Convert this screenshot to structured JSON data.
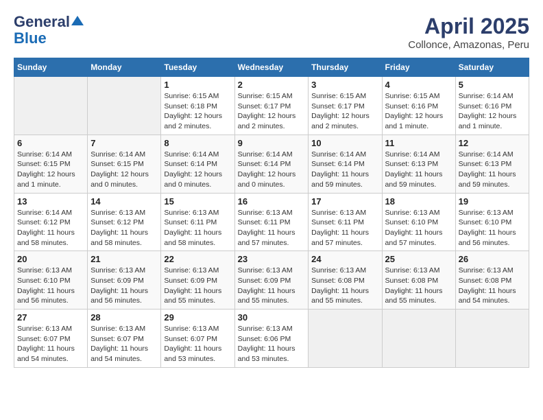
{
  "header": {
    "logo_line1": "General",
    "logo_line2": "Blue",
    "title": "April 2025",
    "subtitle": "Collonce, Amazonas, Peru"
  },
  "weekdays": [
    "Sunday",
    "Monday",
    "Tuesday",
    "Wednesday",
    "Thursday",
    "Friday",
    "Saturday"
  ],
  "weeks": [
    [
      {
        "day": "",
        "detail": ""
      },
      {
        "day": "",
        "detail": ""
      },
      {
        "day": "1",
        "detail": "Sunrise: 6:15 AM\nSunset: 6:18 PM\nDaylight: 12 hours and 2 minutes."
      },
      {
        "day": "2",
        "detail": "Sunrise: 6:15 AM\nSunset: 6:17 PM\nDaylight: 12 hours and 2 minutes."
      },
      {
        "day": "3",
        "detail": "Sunrise: 6:15 AM\nSunset: 6:17 PM\nDaylight: 12 hours and 2 minutes."
      },
      {
        "day": "4",
        "detail": "Sunrise: 6:15 AM\nSunset: 6:16 PM\nDaylight: 12 hours and 1 minute."
      },
      {
        "day": "5",
        "detail": "Sunrise: 6:14 AM\nSunset: 6:16 PM\nDaylight: 12 hours and 1 minute."
      }
    ],
    [
      {
        "day": "6",
        "detail": "Sunrise: 6:14 AM\nSunset: 6:15 PM\nDaylight: 12 hours and 1 minute."
      },
      {
        "day": "7",
        "detail": "Sunrise: 6:14 AM\nSunset: 6:15 PM\nDaylight: 12 hours and 0 minutes."
      },
      {
        "day": "8",
        "detail": "Sunrise: 6:14 AM\nSunset: 6:14 PM\nDaylight: 12 hours and 0 minutes."
      },
      {
        "day": "9",
        "detail": "Sunrise: 6:14 AM\nSunset: 6:14 PM\nDaylight: 12 hours and 0 minutes."
      },
      {
        "day": "10",
        "detail": "Sunrise: 6:14 AM\nSunset: 6:14 PM\nDaylight: 11 hours and 59 minutes."
      },
      {
        "day": "11",
        "detail": "Sunrise: 6:14 AM\nSunset: 6:13 PM\nDaylight: 11 hours and 59 minutes."
      },
      {
        "day": "12",
        "detail": "Sunrise: 6:14 AM\nSunset: 6:13 PM\nDaylight: 11 hours and 59 minutes."
      }
    ],
    [
      {
        "day": "13",
        "detail": "Sunrise: 6:14 AM\nSunset: 6:12 PM\nDaylight: 11 hours and 58 minutes."
      },
      {
        "day": "14",
        "detail": "Sunrise: 6:13 AM\nSunset: 6:12 PM\nDaylight: 11 hours and 58 minutes."
      },
      {
        "day": "15",
        "detail": "Sunrise: 6:13 AM\nSunset: 6:11 PM\nDaylight: 11 hours and 58 minutes."
      },
      {
        "day": "16",
        "detail": "Sunrise: 6:13 AM\nSunset: 6:11 PM\nDaylight: 11 hours and 57 minutes."
      },
      {
        "day": "17",
        "detail": "Sunrise: 6:13 AM\nSunset: 6:11 PM\nDaylight: 11 hours and 57 minutes."
      },
      {
        "day": "18",
        "detail": "Sunrise: 6:13 AM\nSunset: 6:10 PM\nDaylight: 11 hours and 57 minutes."
      },
      {
        "day": "19",
        "detail": "Sunrise: 6:13 AM\nSunset: 6:10 PM\nDaylight: 11 hours and 56 minutes."
      }
    ],
    [
      {
        "day": "20",
        "detail": "Sunrise: 6:13 AM\nSunset: 6:10 PM\nDaylight: 11 hours and 56 minutes."
      },
      {
        "day": "21",
        "detail": "Sunrise: 6:13 AM\nSunset: 6:09 PM\nDaylight: 11 hours and 56 minutes."
      },
      {
        "day": "22",
        "detail": "Sunrise: 6:13 AM\nSunset: 6:09 PM\nDaylight: 11 hours and 55 minutes."
      },
      {
        "day": "23",
        "detail": "Sunrise: 6:13 AM\nSunset: 6:09 PM\nDaylight: 11 hours and 55 minutes."
      },
      {
        "day": "24",
        "detail": "Sunrise: 6:13 AM\nSunset: 6:08 PM\nDaylight: 11 hours and 55 minutes."
      },
      {
        "day": "25",
        "detail": "Sunrise: 6:13 AM\nSunset: 6:08 PM\nDaylight: 11 hours and 55 minutes."
      },
      {
        "day": "26",
        "detail": "Sunrise: 6:13 AM\nSunset: 6:08 PM\nDaylight: 11 hours and 54 minutes."
      }
    ],
    [
      {
        "day": "27",
        "detail": "Sunrise: 6:13 AM\nSunset: 6:07 PM\nDaylight: 11 hours and 54 minutes."
      },
      {
        "day": "28",
        "detail": "Sunrise: 6:13 AM\nSunset: 6:07 PM\nDaylight: 11 hours and 54 minutes."
      },
      {
        "day": "29",
        "detail": "Sunrise: 6:13 AM\nSunset: 6:07 PM\nDaylight: 11 hours and 53 minutes."
      },
      {
        "day": "30",
        "detail": "Sunrise: 6:13 AM\nSunset: 6:06 PM\nDaylight: 11 hours and 53 minutes."
      },
      {
        "day": "",
        "detail": ""
      },
      {
        "day": "",
        "detail": ""
      },
      {
        "day": "",
        "detail": ""
      }
    ]
  ]
}
